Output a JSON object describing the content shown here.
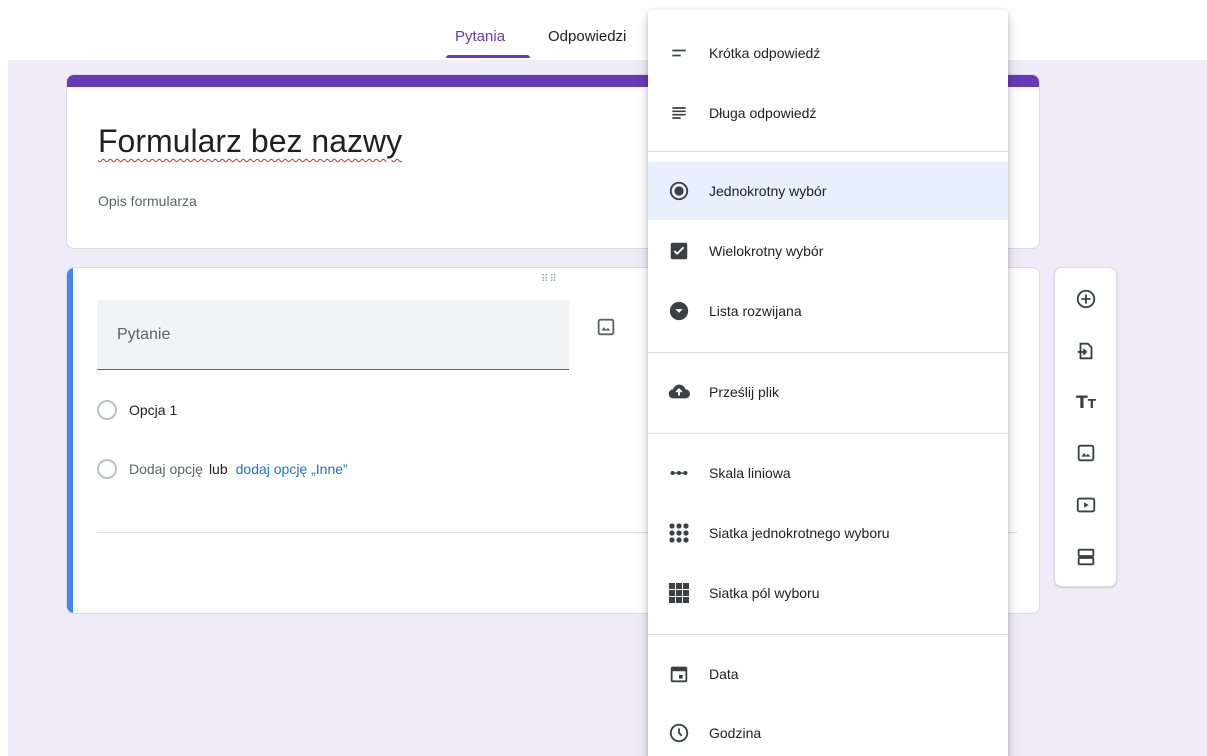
{
  "tabs": {
    "questions": "Pytania",
    "responses": "Odpowiedzi"
  },
  "form": {
    "title": "Formularz bez nazwy",
    "description": "Opis formularza"
  },
  "question": {
    "placeholder": "Pytanie",
    "option1": "Opcja 1",
    "add_option": "Dodaj opcję",
    "or": "lub",
    "add_other": "dodaj opcję „Inne”"
  },
  "menu": {
    "items": [
      {
        "label": "Krótka odpowiedź",
        "icon": "short-text-icon"
      },
      {
        "label": "Długa odpowiedź",
        "icon": "paragraph-icon"
      },
      {
        "label": "Jednokrotny wybór",
        "icon": "radio-button-icon",
        "selected": true
      },
      {
        "label": "Wielokrotny wybór",
        "icon": "checkbox-icon"
      },
      {
        "label": "Lista rozwijana",
        "icon": "dropdown-icon"
      },
      {
        "label": "Prześlij plik",
        "icon": "cloud-upload-icon"
      },
      {
        "label": "Skala liniowa",
        "icon": "linear-scale-icon"
      },
      {
        "label": "Siatka jednokrotnego wyboru",
        "icon": "grid-dots-icon"
      },
      {
        "label": "Siatka pól wyboru",
        "icon": "grid-squares-icon"
      },
      {
        "label": "Data",
        "icon": "calendar-icon"
      },
      {
        "label": "Godzina",
        "icon": "clock-icon"
      }
    ]
  },
  "toolbar": {
    "icons": [
      "add-question-icon",
      "import-questions-icon",
      "add-title-icon",
      "add-image-icon",
      "add-video-icon",
      "add-section-icon"
    ]
  },
  "colors": {
    "accent": "#673ab7",
    "question_stripe": "#4285f4",
    "link": "#1a73e8",
    "selected_bg": "#e8f0fe",
    "background": "#f0ebf8"
  }
}
